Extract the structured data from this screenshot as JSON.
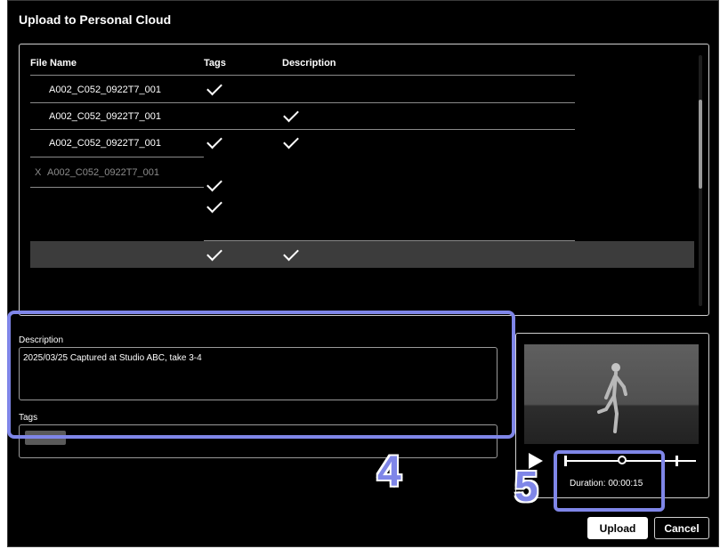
{
  "dialog": {
    "title": "Upload to Personal Cloud"
  },
  "table": {
    "headers": {
      "file_name": "File Name",
      "tags": "Tags",
      "description": "Description"
    },
    "rows": [
      {
        "name": "A002_C052_0922T7_001",
        "tags": true,
        "description": false,
        "prefix": ""
      },
      {
        "name": "A002_C052_0922T7_001",
        "tags": false,
        "description": true,
        "prefix": ""
      },
      {
        "name": "A002_C052_0922T7_001",
        "tags": true,
        "description": true,
        "prefix": ""
      },
      {
        "name": "A002_C052_0922T7_001",
        "tags": true,
        "description": false,
        "prefix": "X"
      },
      {
        "name": "",
        "tags": true,
        "description": false,
        "prefix": ""
      },
      {
        "name": "",
        "tags": true,
        "description": true,
        "prefix": "",
        "selected": true
      }
    ]
  },
  "form": {
    "description_label": "Description",
    "description_value": "2025/03/25 Captured at Studio ABC, take 3-4",
    "tags_label": "Tags"
  },
  "preview": {
    "duration": "Duration: 00:00:15",
    "play_icon": "play-icon"
  },
  "annotations": {
    "marker_4": "4",
    "marker_5": "5",
    "color": "#7f86e8"
  },
  "buttons": {
    "upload": "Upload",
    "cancel": "Cancel"
  }
}
